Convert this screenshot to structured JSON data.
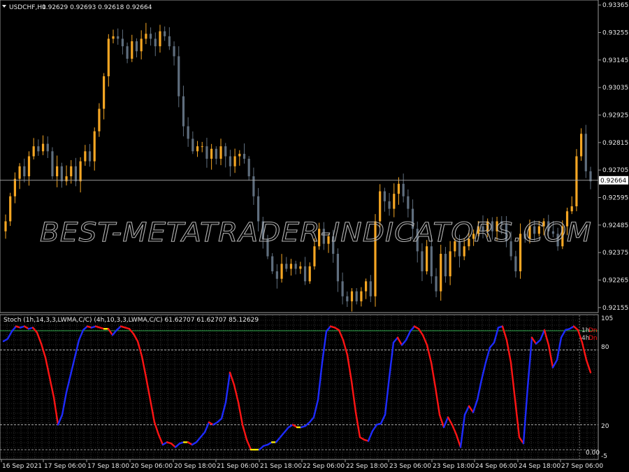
{
  "main": {
    "symbol": "USDCHF,H1",
    "ohlc": "0.92629 0.92693 0.92618 0.92664",
    "price_labels": [
      "0.93365",
      "0.93255",
      "0.93145",
      "0.93035",
      "0.92925",
      "0.92815",
      "0.92705",
      "0.92595",
      "0.92485",
      "0.92375",
      "0.92265",
      "0.92155"
    ],
    "current_price": "0.92664",
    "watermark": "BEST-METATRADER-INDICATORS.COM"
  },
  "indicator": {
    "caption": "Stoch (1h,14,3,3,LWMA,C/C) (4h,10,3,3,LWMA,C/C) 61.62707 61.62707 85.12629",
    "levels": [
      "105",
      "80",
      "20",
      "0.00",
      "-5"
    ],
    "label_1h": "1h",
    "label_4h": "4h",
    "label_dn": "Dn"
  },
  "time_axis": [
    "16 Sep 2021",
    "17 Sep 06:00",
    "17 Sep 18:00",
    "20 Sep 06:00",
    "20 Sep 18:00",
    "21 Sep 06:00",
    "21 Sep 18:00",
    "22 Sep 06:00",
    "22 Sep 18:00",
    "23 Sep 06:00",
    "23 Sep 18:00",
    "24 Sep 06:00",
    "24 Sep 18:00",
    "27 Sep 06:00"
  ],
  "colors": {
    "bull": "#f5a623",
    "bear": "#5f6e7e",
    "stoch_up": "#1e2bff",
    "stoch_down": "#ff1414",
    "stoch_flat": "#ffee00",
    "level_line": "#2eaa4a",
    "grid": "#8a8a8a",
    "text": "#e8e8e8"
  },
  "chart_data": [
    {
      "type": "candlestick",
      "title": "USDCHF,H1",
      "ylim": [
        0.92135,
        0.93385
      ],
      "ticks": [
        0.93365,
        0.93255,
        0.93145,
        0.93035,
        0.92925,
        0.92815,
        0.92705,
        0.92595,
        0.92485,
        0.92375,
        0.92265,
        0.92155
      ],
      "current": 0.92664,
      "closes": [
        0.925,
        0.926,
        0.9267,
        0.9272,
        0.9268,
        0.9276,
        0.928,
        0.9278,
        0.9281,
        0.9278,
        0.9268,
        0.9272,
        0.9266,
        0.9268,
        0.9272,
        0.9266,
        0.9274,
        0.9278,
        0.9274,
        0.9286,
        0.9295,
        0.9308,
        0.9323,
        0.9324,
        0.9323,
        0.932,
        0.9315,
        0.9322,
        0.9318,
        0.9323,
        0.9325,
        0.9323,
        0.932,
        0.9326,
        0.9324,
        0.932,
        0.9316,
        0.93,
        0.9288,
        0.9283,
        0.9278,
        0.928,
        0.928,
        0.9275,
        0.9279,
        0.9275,
        0.928,
        0.9276,
        0.9272,
        0.9276,
        0.9277,
        0.9275,
        0.9268,
        0.926,
        0.925,
        0.9243,
        0.9236,
        0.923,
        0.9227,
        0.9233,
        0.9231,
        0.9233,
        0.9231,
        0.9232,
        0.9226,
        0.9232,
        0.924,
        0.9247,
        0.9241,
        0.9244,
        0.9237,
        0.9226,
        0.922,
        0.9218,
        0.9222,
        0.9218,
        0.9222,
        0.9226,
        0.922,
        0.925,
        0.9262,
        0.9258,
        0.9255,
        0.9261,
        0.9265,
        0.926,
        0.9255,
        0.9247,
        0.9238,
        0.923,
        0.924,
        0.9228,
        0.9222,
        0.9237,
        0.9228,
        0.9238,
        0.9242,
        0.9236,
        0.924,
        0.9243,
        0.9245,
        0.9248,
        0.9246,
        0.925,
        0.9246,
        0.925,
        0.9249,
        0.9242,
        0.9236,
        0.923,
        0.9245,
        0.9243,
        0.9248,
        0.9245,
        0.9248,
        0.925,
        0.9246,
        0.9245,
        0.924,
        0.9248,
        0.9254,
        0.9256,
        0.9276,
        0.9285,
        0.927,
        0.9266
      ],
      "stochastic": {
        "type": "line",
        "ylim": [
          -5,
          105
        ],
        "levels": [
          105,
          80,
          20,
          0
        ],
        "values": [
          87,
          89,
          95,
          99,
          98,
          99,
          97,
          98,
          94,
          85,
          74,
          58,
          42,
          20,
          28,
          46,
          60,
          74,
          88,
          96,
          99,
          98,
          99,
          98,
          97,
          97,
          92,
          96,
          99,
          98,
          97,
          93,
          87,
          75,
          58,
          40,
          22,
          12,
          4,
          6,
          5,
          2,
          5,
          6,
          6,
          4,
          6,
          10,
          14,
          22,
          20,
          22,
          25,
          38,
          62,
          52,
          38,
          20,
          8,
          0,
          0,
          0,
          3,
          4,
          6,
          6,
          10,
          14,
          18,
          20,
          18,
          18,
          19,
          22,
          26,
          40,
          70,
          95,
          99,
          98,
          96,
          88,
          76,
          55,
          30,
          10,
          8,
          7,
          15,
          20,
          21,
          28,
          58,
          86,
          90,
          84,
          88,
          95,
          99,
          97,
          92,
          84,
          70,
          50,
          28,
          18,
          26,
          20,
          12,
          2,
          28,
          35,
          30,
          40,
          56,
          70,
          82,
          86,
          98,
          99,
          88,
          70,
          40,
          10,
          5,
          50,
          90,
          85,
          88,
          96,
          84,
          66,
          72,
          90,
          96,
          97,
          99,
          96,
          86,
          72,
          62
        ]
      }
    }
  ]
}
